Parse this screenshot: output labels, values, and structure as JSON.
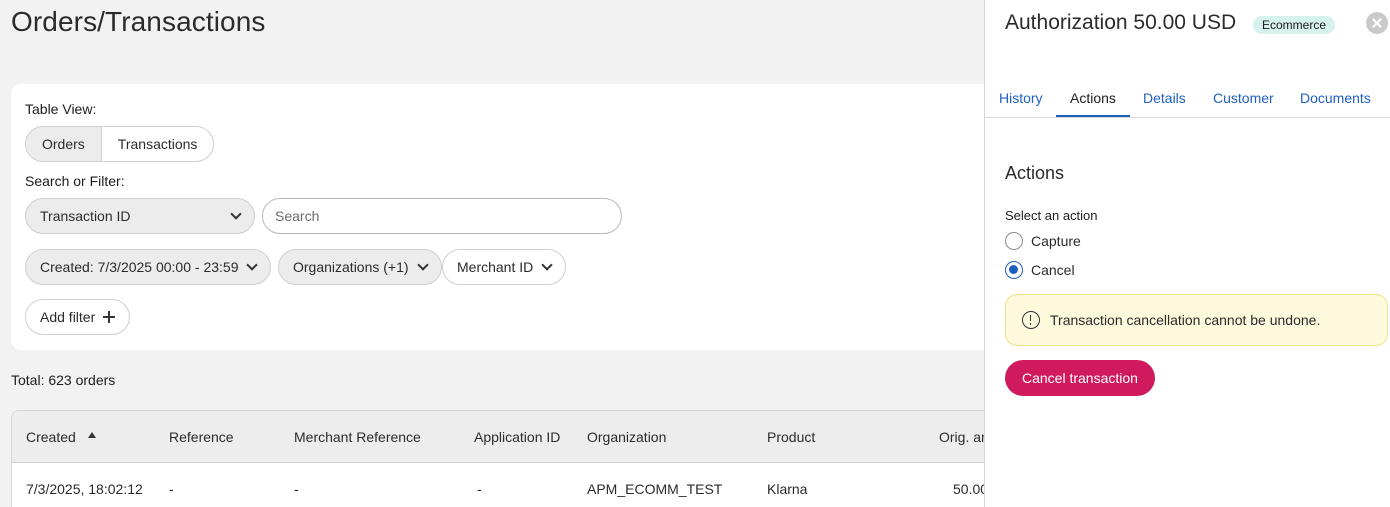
{
  "page": {
    "title": "Orders/Transactions"
  },
  "filters": {
    "table_view_label": "Table View:",
    "view_options": [
      "Orders",
      "Transactions"
    ],
    "selected_view": "Orders",
    "search_label": "Search or Filter:",
    "field_select": "Transaction ID",
    "search_placeholder": "Search",
    "chips": [
      "Created: 7/3/2025 00:00 - 23:59",
      "Organizations (+1)",
      "Merchant ID"
    ],
    "add_filter": "Add filter"
  },
  "summary": {
    "total": "Total: 623 orders"
  },
  "table": {
    "columns": [
      "Created",
      "Reference",
      "Merchant Reference",
      "Application ID",
      "Organization",
      "Product",
      "Orig. am"
    ],
    "rows": [
      [
        "7/3/2025, 18:02:12",
        "-",
        "-",
        "-",
        "APM_ECOMM_TEST",
        "Klarna",
        "50.00"
      ]
    ]
  },
  "panel": {
    "title": "Authorization 50.00 USD",
    "badge": "Ecommerce",
    "tabs": [
      "History",
      "Actions",
      "Details",
      "Customer",
      "Documents"
    ],
    "active_tab": "Actions",
    "section_title": "Actions",
    "select_label": "Select an action",
    "options": [
      "Capture",
      "Cancel"
    ],
    "selected_option": "Cancel",
    "warning": "Transaction cancellation cannot be undone.",
    "primary_button": "Cancel transaction",
    "colors": {
      "primary": "#d11a5d",
      "link": "#1f5fbf",
      "badge_bg": "#d7f1ee",
      "warning_bg": "#fdf9dc"
    }
  }
}
